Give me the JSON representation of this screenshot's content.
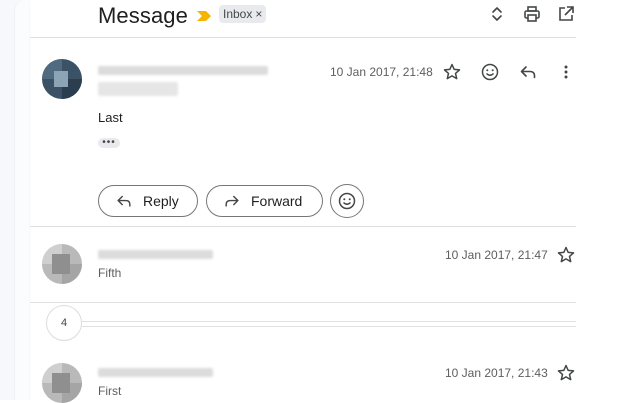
{
  "header": {
    "subject": "Message",
    "label": "Inbox",
    "label_remove": "×",
    "icons": [
      "expand-collapse-icon",
      "print-icon",
      "open-in-new-window-icon"
    ]
  },
  "messages": [
    {
      "date": "10 Jan 2017, 21:48",
      "body": "Last",
      "ellipsis": "•••",
      "actions": [
        "star-icon",
        "emoji-reaction-icon",
        "reply-icon",
        "more-icon"
      ]
    },
    {
      "date": "10 Jan 2017, 21:47",
      "snippet": "Fifth",
      "actions": [
        "star-icon"
      ]
    },
    {
      "date": "10 Jan 2017, 21:43",
      "snippet": "First",
      "actions": [
        "star-icon"
      ]
    }
  ],
  "buttons": {
    "reply": "Reply",
    "forward": "Forward"
  },
  "collapsed_count": "4",
  "colors": {
    "importance_marker": "#f4b400",
    "label_chip_bg": "#e8eaed",
    "divider": "#e0e0e0"
  }
}
